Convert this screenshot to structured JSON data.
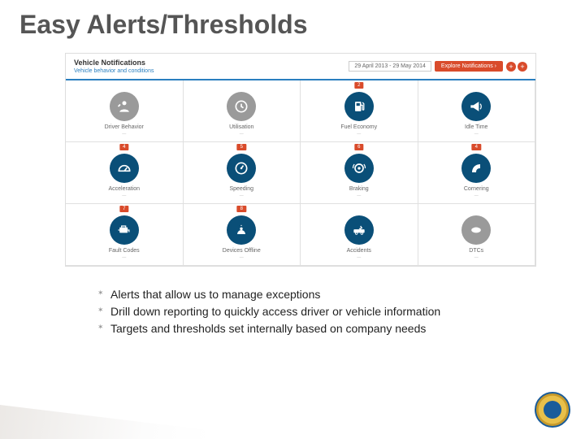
{
  "title": "Easy Alerts/Thresholds",
  "dashboard": {
    "heading": "Vehicle Notifications",
    "sub": "Vehicle behavior and conditions",
    "dateRange": "29 April 2013 - 29 May 2014",
    "exploreLabel": "Explore Notifications ›",
    "cells": [
      {
        "label": "Driver Behavior",
        "badge": "",
        "color": "gray",
        "icon": "person"
      },
      {
        "label": "Utilisation",
        "badge": "",
        "color": "gray",
        "icon": "clock"
      },
      {
        "label": "Fuel Economy",
        "badge": "2",
        "color": "blue",
        "icon": "fuel"
      },
      {
        "label": "Idle Time",
        "badge": "",
        "color": "blue",
        "icon": "horn"
      },
      {
        "label": "Acceleration",
        "badge": "4",
        "color": "blue",
        "icon": "gauge"
      },
      {
        "label": "Speeding",
        "badge": "5",
        "color": "blue",
        "icon": "speed"
      },
      {
        "label": "Braking",
        "badge": "6",
        "color": "blue",
        "icon": "brake"
      },
      {
        "label": "Cornering",
        "badge": "4",
        "color": "blue",
        "icon": "corner"
      },
      {
        "label": "Fault Codes",
        "badge": "7",
        "color": "blue",
        "icon": "engine"
      },
      {
        "label": "Devices Offline",
        "badge": "8",
        "color": "blue",
        "icon": "offline"
      },
      {
        "label": "Accidents",
        "badge": "",
        "color": "blue",
        "icon": "accident"
      },
      {
        "label": "DTCs",
        "badge": "",
        "color": "gray",
        "icon": "dtc"
      }
    ]
  },
  "bullets": [
    "Alerts that allow us to manage exceptions",
    "Drill down reporting to quickly access driver or vehicle information",
    "Targets and thresholds set internally based on company needs"
  ]
}
